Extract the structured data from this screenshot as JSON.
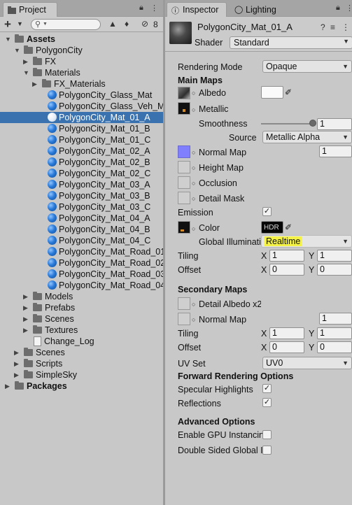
{
  "project": {
    "tab_label": "Project",
    "hidden_count": "8",
    "tree": [
      {
        "label": "Assets",
        "indent": 0,
        "type": "folder",
        "expanded": true,
        "bold": true
      },
      {
        "label": "PolygonCity",
        "indent": 1,
        "type": "folder",
        "expanded": true
      },
      {
        "label": "FX",
        "indent": 2,
        "type": "folder",
        "expanded": false
      },
      {
        "label": "Materials",
        "indent": 2,
        "type": "folder",
        "expanded": true
      },
      {
        "label": "FX_Materials",
        "indent": 3,
        "type": "folder",
        "expanded": false
      },
      {
        "label": "PolygonCity_Glass_Mat",
        "indent": 3,
        "type": "material"
      },
      {
        "label": "PolygonCity_Glass_Veh_Ma",
        "indent": 3,
        "type": "material"
      },
      {
        "label": "PolygonCity_Mat_01_A",
        "indent": 3,
        "type": "material",
        "selected": true
      },
      {
        "label": "PolygonCity_Mat_01_B",
        "indent": 3,
        "type": "material"
      },
      {
        "label": "PolygonCity_Mat_01_C",
        "indent": 3,
        "type": "material"
      },
      {
        "label": "PolygonCity_Mat_02_A",
        "indent": 3,
        "type": "material"
      },
      {
        "label": "PolygonCity_Mat_02_B",
        "indent": 3,
        "type": "material"
      },
      {
        "label": "PolygonCity_Mat_02_C",
        "indent": 3,
        "type": "material"
      },
      {
        "label": "PolygonCity_Mat_03_A",
        "indent": 3,
        "type": "material"
      },
      {
        "label": "PolygonCity_Mat_03_B",
        "indent": 3,
        "type": "material"
      },
      {
        "label": "PolygonCity_Mat_03_C",
        "indent": 3,
        "type": "material"
      },
      {
        "label": "PolygonCity_Mat_04_A",
        "indent": 3,
        "type": "material"
      },
      {
        "label": "PolygonCity_Mat_04_B",
        "indent": 3,
        "type": "material"
      },
      {
        "label": "PolygonCity_Mat_04_C",
        "indent": 3,
        "type": "material"
      },
      {
        "label": "PolygonCity_Mat_Road_01",
        "indent": 3,
        "type": "material"
      },
      {
        "label": "PolygonCity_Mat_Road_02",
        "indent": 3,
        "type": "material"
      },
      {
        "label": "PolygonCity_Mat_Road_03",
        "indent": 3,
        "type": "material"
      },
      {
        "label": "PolygonCity_Mat_Road_04",
        "indent": 3,
        "type": "material"
      },
      {
        "label": "Models",
        "indent": 2,
        "type": "folder",
        "expanded": false
      },
      {
        "label": "Prefabs",
        "indent": 2,
        "type": "folder",
        "expanded": false
      },
      {
        "label": "Scenes",
        "indent": 2,
        "type": "folder",
        "expanded": false
      },
      {
        "label": "Textures",
        "indent": 2,
        "type": "folder",
        "expanded": false
      },
      {
        "label": "Change_Log",
        "indent": 2,
        "type": "document"
      },
      {
        "label": "Scenes",
        "indent": 1,
        "type": "folder",
        "expanded": false
      },
      {
        "label": "Scripts",
        "indent": 1,
        "type": "folder",
        "expanded": false
      },
      {
        "label": "SimpleSky",
        "indent": 1,
        "type": "folder",
        "expanded": false
      },
      {
        "label": "Packages",
        "indent": 0,
        "type": "folder",
        "expanded": false,
        "bold": true
      }
    ]
  },
  "inspector": {
    "tab_label": "Inspector",
    "lighting_tab_label": "Lighting",
    "material_name": "PolygonCity_Mat_01_A",
    "shader_label": "Shader",
    "shader_value": "Standard",
    "rendering_mode_label": "Rendering Mode",
    "rendering_mode_value": "Opaque",
    "main_maps_title": "Main Maps",
    "albedo_label": "Albedo",
    "metallic_label": "Metallic",
    "smoothness_label": "Smoothness",
    "smoothness_value": "1",
    "smoothness_level": 1,
    "source_label": "Source",
    "source_value": "Metallic Alpha",
    "normal_map_label": "Normal Map",
    "normal_map_value": "1",
    "height_map_label": "Height Map",
    "occlusion_label": "Occlusion",
    "detail_mask_label": "Detail Mask",
    "emission_label": "Emission",
    "emission_checked": true,
    "color_label": "Color",
    "hdr_label": "HDR",
    "global_illum_label": "Global Illuminati",
    "global_illum_value": "Realtime",
    "tiling_label": "Tiling",
    "offset_label": "Offset",
    "x_label": "X",
    "y_label": "Y",
    "main_tiling_x": "1",
    "main_tiling_y": "1",
    "main_offset_x": "0",
    "main_offset_y": "0",
    "secondary_maps_title": "Secondary Maps",
    "detail_albedo_label": "Detail Albedo x2",
    "secondary_normal_label": "Normal Map",
    "secondary_normal_value": "1",
    "sec_tiling_x": "1",
    "sec_tiling_y": "1",
    "sec_offset_x": "0",
    "sec_offset_y": "0",
    "uv_set_label": "UV Set",
    "uv_set_value": "UV0",
    "forward_title": "Forward Rendering Options",
    "specular_label": "Specular Highlights",
    "specular_checked": true,
    "reflections_label": "Reflections",
    "reflections_checked": true,
    "advanced_title": "Advanced Options",
    "gpu_instancing_label": "Enable GPU Instancin",
    "gpu_instancing_checked": false,
    "double_sided_label": "Double Sided Global I",
    "double_sided_checked": false
  },
  "colors": {
    "selection": "#3a72b0",
    "highlight": "#f4f245",
    "normal_map_swatch": "#8080ff",
    "material_icon": "#2a7ad8"
  }
}
